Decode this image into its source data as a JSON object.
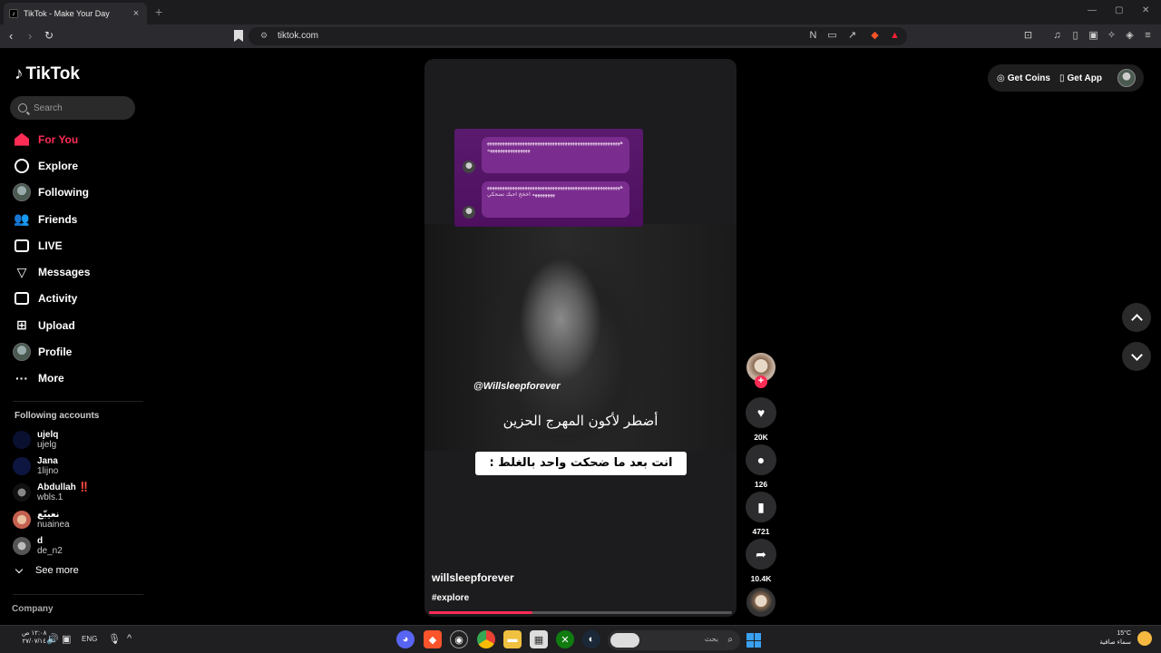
{
  "browser": {
    "tab_title": "TikTok - Make Your Day",
    "tab_favicon": "tiktok-icon",
    "tab_close": "×",
    "new_tab": "+",
    "url": "tiktok.com",
    "window_controls": [
      "—",
      "▢",
      "✕"
    ]
  },
  "app": {
    "logo": "TikTok",
    "search_placeholder": "Search",
    "top_actions": {
      "get_coins": "Get Coins",
      "get_app": "Get App"
    },
    "accent_color": "#fe2c55"
  },
  "sidebar": {
    "items": [
      {
        "label": "For You",
        "icon": "home-icon",
        "active": true
      },
      {
        "label": "Explore",
        "icon": "compass-icon"
      },
      {
        "label": "Following",
        "icon": "avatar-icon"
      },
      {
        "label": "Friends",
        "icon": "friends-icon"
      },
      {
        "label": "LIVE",
        "icon": "live-tv-icon"
      },
      {
        "label": "Messages",
        "icon": "send-icon"
      },
      {
        "label": "Activity",
        "icon": "message-box-icon"
      },
      {
        "label": "Upload",
        "icon": "plus-box-icon"
      },
      {
        "label": "Profile",
        "icon": "avatar-icon"
      },
      {
        "label": "More",
        "icon": "ellipsis-icon"
      }
    ],
    "following_title": "Following accounts",
    "following": [
      {
        "name": "ujelq",
        "handle": "ujelg",
        "color": "#0a1030"
      },
      {
        "name": "Jana",
        "handle": "1lijno",
        "color": "#0d1640"
      },
      {
        "name": "Abdullah ‼️",
        "handle": "wbls.1",
        "color": "#222"
      },
      {
        "name": "نعيبّع",
        "handle": "nuainea",
        "color": "#c46050"
      },
      {
        "name": "d",
        "handle": "de_n2",
        "color": "#666"
      }
    ],
    "see_more": "See more",
    "company": "Company"
  },
  "video": {
    "chat_lines": [
      "ههههههههههههههههههههههههههههههههههههههههههههههههههههههههههههههههههههههه",
      "ههههههههههههههههههههههههههههههههههههههههههههههههههههههههههههههه اخخخ احبك تضحكي"
    ],
    "overlay_handle": "@Willsleepforever",
    "caption_line1": "أضطر لأكون المهرج الحزين",
    "caption_line2": "انت بعد ما ضحكت واحد بالغلط :",
    "author": "willsleepforever",
    "hashtag": "#explore",
    "progress": 0.34
  },
  "actions": {
    "likes": "20K",
    "comments": "126",
    "saves": "4721",
    "shares": "10.4K"
  },
  "taskbar": {
    "time": "١٢:٠٨ ص",
    "date": "٢٧/٠٧/١٤",
    "lang": "ENG",
    "search_text": "بحث",
    "weather_temp": "15°C",
    "weather_desc": "سماء صافية"
  }
}
